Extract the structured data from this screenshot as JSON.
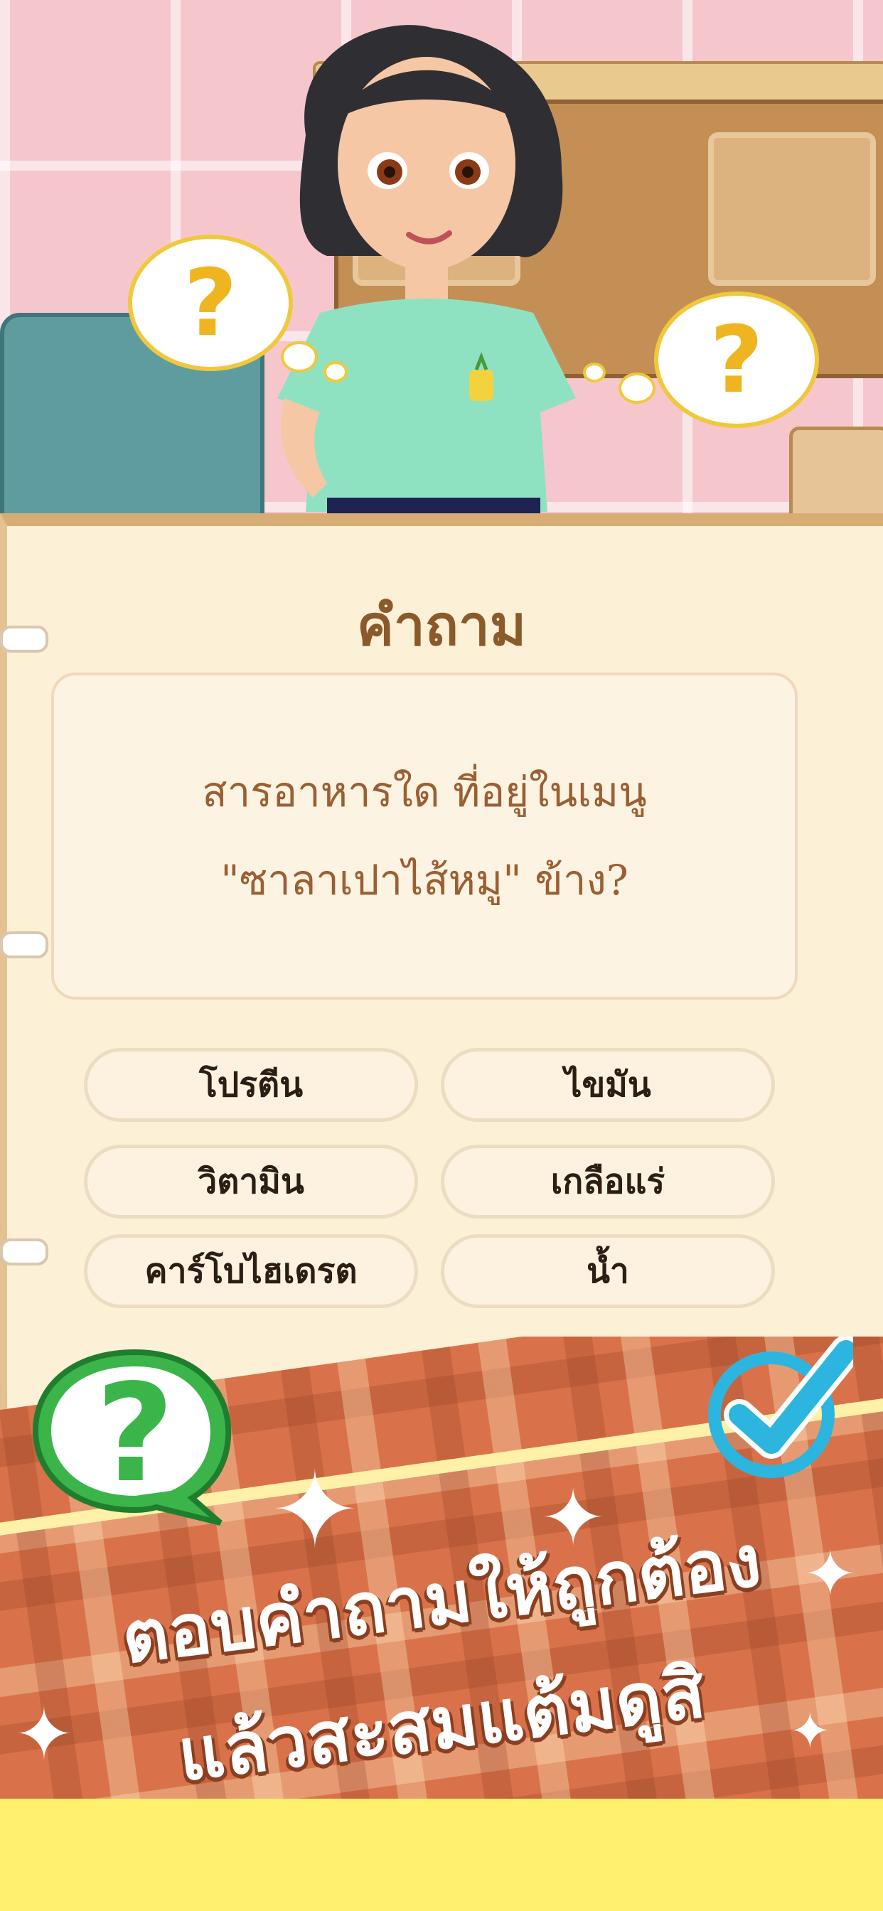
{
  "quiz": {
    "title": "คำถาม",
    "question_line1": "สารอาหารใด ที่อยู่ในเมนู",
    "question_line2": "\"ซาลาเปาไส้หมู\" ข้าง?",
    "options": [
      {
        "label": "โปรตีน"
      },
      {
        "label": "ไขมัน"
      },
      {
        "label": "วิตามิน"
      },
      {
        "label": "เกลือแร่"
      },
      {
        "label": "คาร์โบไฮเดรต"
      },
      {
        "label": "น้ำ"
      }
    ]
  },
  "thought_bubbles": {
    "left_symbol": "?",
    "right_symbol": "?"
  },
  "promo": {
    "headline_line1": "ตอบคำถามให้ถูกต้อง",
    "headline_line2": "แล้วสะสมแต้มดูสิ",
    "help_icon_symbol": "?",
    "sparkle_symbol": "✦"
  },
  "colors": {
    "title_brown": "#8b5a2b",
    "question_text": "#9a5f33",
    "help_green": "#3bb54a",
    "check_blue": "#2cb5df",
    "banner_plaid": "#d9724a",
    "bottom_yellow": "#fff06e"
  }
}
